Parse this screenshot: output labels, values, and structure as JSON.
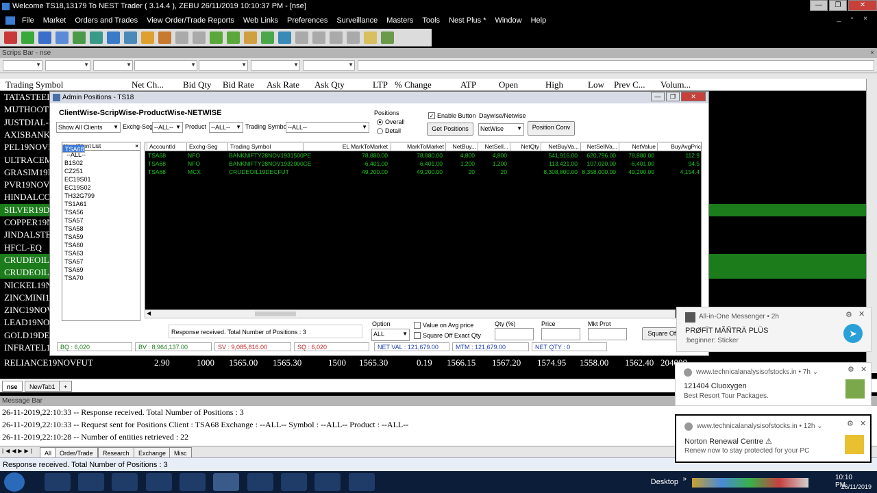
{
  "window": {
    "title": "Welcome TS18,13179 To NEST Trader ( 3.14.4 ),  ZEBU  26/11/2019  10:10:37 PM - [nse]",
    "btn_min": "—",
    "btn_max": "❐",
    "btn_close": "✕"
  },
  "menu": [
    "File",
    "Market",
    "Orders and Trades",
    "View Order/Trade Reports",
    "Web Links",
    "Preferences",
    "Surveillance",
    "Masters",
    "Tools",
    "Nest Plus *",
    "Window",
    "Help"
  ],
  "menu_mdi": "_ ▫ ×",
  "scrips_bar": {
    "title": "Scrips Bar - nse",
    "close": "×"
  },
  "market_watch": {
    "headers": [
      "Trading Symbol",
      "Net Ch...",
      "Bid Qty",
      "Bid Rate",
      "Ask Rate",
      "Ask Qty",
      "LTP",
      "% Change",
      "ATP",
      "Open",
      "High",
      "Low",
      "Prev C...",
      "Volum..."
    ],
    "rows": [
      {
        "symbol": "TATASTEEL",
        "green": false
      },
      {
        "symbol": "MUTHOOTF",
        "green": false
      },
      {
        "symbol": "JUSTDIAL-E",
        "green": false
      },
      {
        "symbol": "AXISBANK-E",
        "green": false
      },
      {
        "symbol": "PEL19NOVF",
        "green": false
      },
      {
        "symbol": "ULTRACEM",
        "green": false
      },
      {
        "symbol": "GRASIM19N",
        "green": false
      },
      {
        "symbol": "PVR19NOVF",
        "green": false
      },
      {
        "symbol": "HINDALCO1",
        "green": false
      },
      {
        "symbol": "SILVER19DE",
        "green": true
      },
      {
        "symbol": "COPPER19N",
        "green": false
      },
      {
        "symbol": "JINDALSTE",
        "green": false
      },
      {
        "symbol": "HFCL-EQ",
        "green": false
      },
      {
        "symbol": "CRUDEOILA",
        "green": true
      },
      {
        "symbol": "CRUDEOIL1",
        "green": true
      },
      {
        "symbol": "NICKEL19N",
        "green": false
      },
      {
        "symbol": "ZINCMINI19",
        "green": false
      },
      {
        "symbol": "ZINC19NOV",
        "green": false
      },
      {
        "symbol": "LEAD19NOV",
        "green": false
      },
      {
        "symbol": "GOLD19DEC",
        "green": false
      },
      {
        "symbol": "INFRATEL19",
        "green": false
      }
    ],
    "last_row": {
      "symbol": "RELIANCE19NOVFUT",
      "net_ch": "2.90",
      "bid_qty": "1000",
      "bid_rate": "1565.00",
      "ask_rate": "1565.30",
      "ask_qty": "1500",
      "ltp": "1565.30",
      "pct_change": "0.19",
      "atp": "1566.15",
      "open": "1567.20",
      "high": "1574.95",
      "low": "1558.00",
      "prev_close": "1562.40",
      "volume": "204000"
    }
  },
  "admin": {
    "title": "Admin Positions - TS18",
    "heading": "ClientWise-ScripWise-ProductWise-NETWISE",
    "show_all": "Show All Clients",
    "exchg_seg_label": "Exchg-Seg",
    "exchg_seg_value": "--ALL--",
    "product_label": "Product",
    "product_value": "--ALL--",
    "symbol_label": "Trading Symbol",
    "symbol_value": "--ALL--",
    "positions_label": "Positions",
    "overall": "Overall",
    "detail": "Detail",
    "enable_button": "Enable Button",
    "get_positions": "Get Positions",
    "daywise_label": "Daywise/Netwise",
    "netwise_value": "NetWise",
    "position_conv": "Position Conv",
    "user_list_header": "User/Client List",
    "user_list_close": "×",
    "users": [
      "--ALL--",
      "B1S02",
      "CZ251",
      "EC19S01",
      "EC19S02",
      "TH32G799",
      "TS1A61",
      "TSA56",
      "TSA57",
      "TSA58",
      "TSA59",
      "TSA60",
      "TSA63",
      "TSA67",
      "TSA68",
      "TSA69",
      "TSA70"
    ],
    "selected_user": "TSA68",
    "columns": [
      "AccountId",
      "Exchg-Seg",
      "Trading Symbol",
      "EL MarkToMarket",
      "MarkToMarket",
      "NetBuy...",
      "NetSell...",
      "NetQty",
      "NetBuyVa...",
      "NetSellVa...",
      "NetValue",
      "BuyAvgPric"
    ],
    "positions": [
      [
        "TSA68",
        "NFO",
        "BANKNIFTY28NOV1931500PE",
        "78,880.00",
        "78,880.00",
        "4,800",
        "4,800",
        "",
        "541,916.00",
        "620,796.00",
        "78,880.00",
        "112.9"
      ],
      [
        "TSA68",
        "NFO",
        "BANKNIFTY28NOV1932000CE",
        "-6,401.00",
        "-6,401.00",
        "1,200",
        "1,200",
        "",
        "113,421.00",
        "107,020.00",
        "-6,401.00",
        "94.5"
      ],
      [
        "TSA68",
        "MCX",
        "CRUDEOIL19DECFUT",
        "49,200.00",
        "49,200.00",
        "20",
        "20",
        "",
        "8,308,800.00",
        "8,358,000.00",
        "49,200.00",
        "4,154.4"
      ]
    ],
    "response_text": "Response received. Total Number of Positions : 3",
    "option_label": "Option",
    "option_value": "ALL",
    "value_on_avg": "Value on Avg  price",
    "square_off_exact": "Square Off Exact Qty",
    "qty_pct_label": "Qty (%)",
    "price_label": "Price",
    "mkt_prot_label": "Mkt Prot",
    "square_off_btn": "Square Off",
    "stats": {
      "bq": "BQ : 6,020",
      "bv": "BV : 8,964,137.00",
      "sv": "SV : 9,085,816.00",
      "sq": "SQ : 6,020",
      "net_val": "NET VAL : 121,679.00",
      "mtm": "MTM : 121,679.00",
      "net_qty": "NET QTY : 0"
    }
  },
  "tabs": [
    "nse",
    "NewTab1",
    "+"
  ],
  "message_bar": {
    "title": "Message Bar",
    "lines": [
      "26-11-2019,22:10:33  -- Response received. Total Number of Positions : 3",
      "26-11-2019,22:10:33  -- Request sent for Positions  Client : TSA68 Exchange : --ALL-- Symbol : --ALL-- Product : --ALL--",
      "26-11-2019,22:10:28  -- Number of entities retrieved : 22"
    ],
    "tabs": [
      "All",
      "Order/Trade",
      "Research",
      "Exchange",
      "Misc"
    ]
  },
  "status_text": "Response received. Total Number of Positions : 3",
  "notifications": [
    {
      "source": "All-in-One Messenger  •  2h",
      "title": "PRØFÏT MÃÑTRÄ PLÜS",
      "body": ":beginner: Sticker"
    },
    {
      "source": "www.technicalanalysisofstocks.in  •  7h ⌄",
      "title": "121404 Cluoxygen",
      "body": "Best Resort Tour Packages."
    },
    {
      "source": "www.technicalanalysisofstocks.in  •  12h ⌄",
      "title": "Norton Renewal Centre ⚠",
      "body": "Renew now to stay protected for your PC"
    }
  ],
  "taskbar": {
    "desktop": "Desktop",
    "time": "10:10 PM",
    "date": "26/11/2019",
    "chevron": "»"
  },
  "colors": {
    "accent": "#3a78d8",
    "grid_green": "#1ec81e",
    "row_green": "#1c7c1c"
  }
}
